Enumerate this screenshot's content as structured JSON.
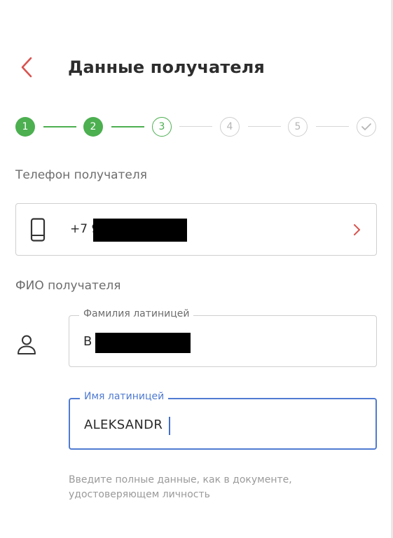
{
  "header": {
    "title": "Данные получателя",
    "back_icon": "chevron-left-icon",
    "accent_color": "#d9534f"
  },
  "stepper": {
    "steps": [
      {
        "label": "1",
        "state": "done"
      },
      {
        "label": "2",
        "state": "done"
      },
      {
        "label": "3",
        "state": "active"
      },
      {
        "label": "4",
        "state": "pending"
      },
      {
        "label": "5",
        "state": "pending"
      },
      {
        "label": "",
        "state": "pending",
        "icon": "check-icon"
      }
    ],
    "colors": {
      "done": "#4caf50",
      "pending": "#cfcfcf"
    }
  },
  "phone_section": {
    "label": "Телефон получателя",
    "value_visible": "+7 9",
    "icon": "smartphone-icon",
    "action_icon": "chevron-right-icon"
  },
  "name_section": {
    "label": "ФИО получателя",
    "icon": "person-icon",
    "surname": {
      "legend": "Фамилия латиницей",
      "value_visible": "B"
    },
    "first_name": {
      "legend": "Имя латиницей",
      "value": "ALEKSANDR",
      "focused": true
    },
    "hint": "Введите полные данные, как в документе, удостоверяющем личность",
    "focus_color": "#4f7bd1"
  }
}
